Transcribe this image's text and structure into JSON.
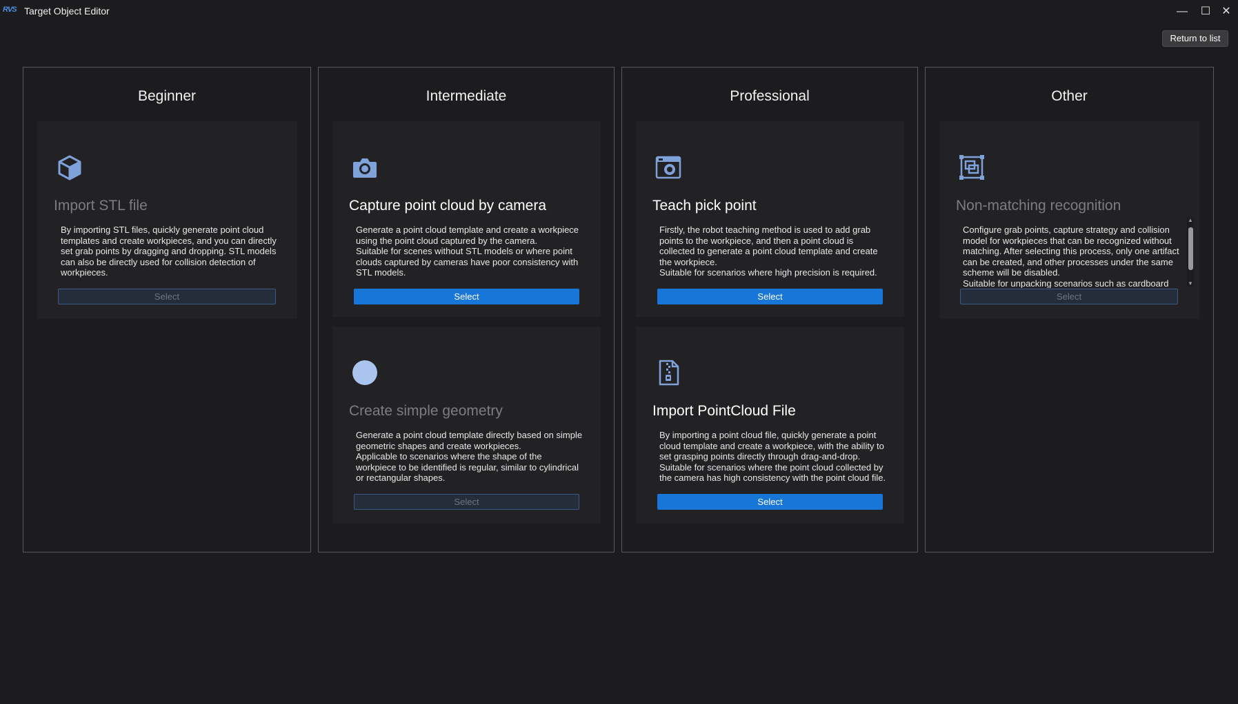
{
  "window": {
    "title": "Target Object Editor",
    "logo": "RVS",
    "minimize_icon": "—",
    "maximize_icon": "☐",
    "close_icon": "✕"
  },
  "header": {
    "return_label": "Return to list"
  },
  "colors": {
    "accent": "#1976d9",
    "icon": "#7ea2d9",
    "disabled_text": "#7d7d80"
  },
  "columns": [
    {
      "title": "Beginner",
      "cards": [
        {
          "icon": "cube-icon",
          "title": "Import STL file",
          "enabled": false,
          "description": "By importing STL files, quickly generate point cloud\ntemplates and create workpieces, and you can directly\nset grab points by dragging and dropping. STL models\ncan also be directly used for collision detection of\nworkpieces.",
          "button": "Select"
        }
      ]
    },
    {
      "title": "Intermediate",
      "cards": [
        {
          "icon": "camera-icon",
          "title": "Capture point cloud by camera",
          "enabled": true,
          "description": "Generate a point cloud template and create a workpiece\nusing the point cloud captured by the camera.\nSuitable for scenes without STL models or where point\nclouds captured by cameras have poor consistency with\nSTL models.",
          "button": "Select"
        },
        {
          "icon": "circle-icon",
          "title": "Create simple geometry",
          "enabled": false,
          "description": "Generate a point cloud template directly based on simple\ngeometric shapes and create workpieces.\nApplicable to scenarios where the shape of the\nworkpiece to be identified is regular, similar to cylindrical\nor rectangular shapes.",
          "button": "Select"
        }
      ]
    },
    {
      "title": "Professional",
      "cards": [
        {
          "icon": "photo-camera-icon",
          "title": "Teach pick point",
          "enabled": true,
          "description": "Firstly, the robot teaching method is used to add grab\npoints to the workpiece, and then a point cloud is\ncollected to generate a point cloud template and create\nthe workpiece.\nSuitable for scenarios where high precision is required.",
          "button": "Select"
        },
        {
          "icon": "file-zip-icon",
          "title": "Import PointCloud File",
          "enabled": true,
          "description": "By importing a point cloud file, quickly generate a point\ncloud template and create a workpiece, with the ability to\nset grasping points directly through drag-and-drop.\nSuitable for scenarios where the point cloud collected by\nthe camera has high consistency with the point cloud file.",
          "button": "Select"
        }
      ]
    },
    {
      "title": "Other",
      "cards": [
        {
          "icon": "frames-icon",
          "title": "Non-matching recognition",
          "enabled": false,
          "description": "Configure grab points, capture strategy and collision\nmodel for workpieces that can be recognized without\nmatching. After selecting this process, only one artifact\ncan be created, and other processes under the same\nscheme will be disabled.\nSuitable for unpacking scenarios such as cardboard\nboxes and bags.",
          "button": "Select"
        }
      ]
    }
  ]
}
